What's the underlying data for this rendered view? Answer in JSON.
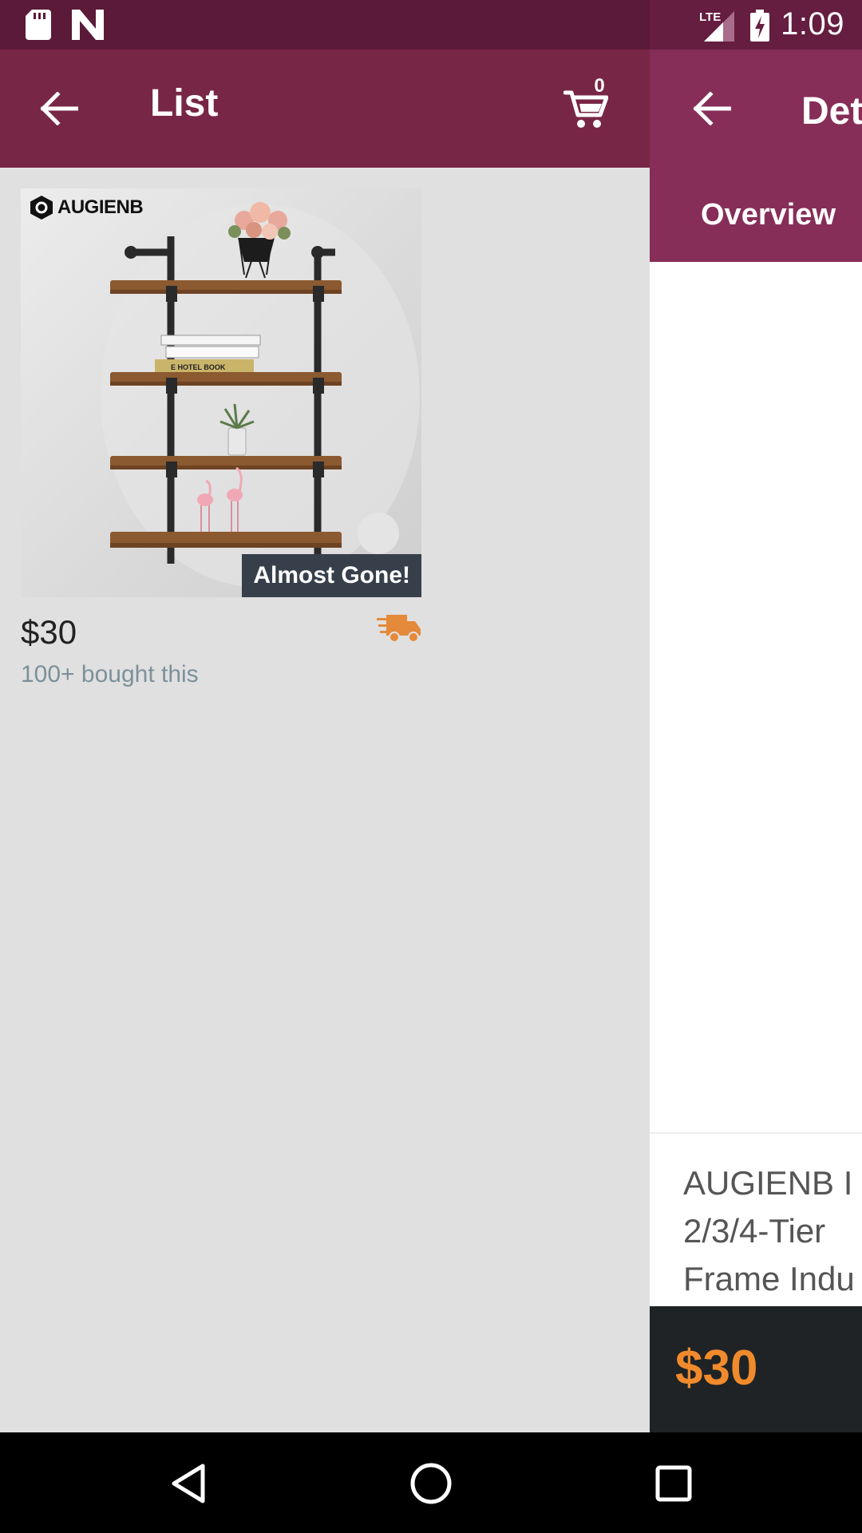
{
  "status_bar": {
    "network": "LTE",
    "time": "1:09",
    "icons": [
      "sd-card-icon",
      "n-logo-icon",
      "lte-signal-icon",
      "battery-charging-icon"
    ]
  },
  "list_screen": {
    "title": "List",
    "cart_count": "0",
    "product": {
      "brand": "AUGIENB",
      "badge": "Almost Gone!",
      "price": "$30",
      "bought_text": "100+ bought this",
      "image_book_text": "E HOTEL BOOK"
    }
  },
  "detail_screen": {
    "title": "Det",
    "tab": "Overview",
    "product_title_lines": [
      "AUGIENB I",
      "2/3/4-Tier",
      "Frame Indu"
    ],
    "price": "$30"
  },
  "colors": {
    "appbar_list": "#782646",
    "appbar_detail": "#862e58",
    "accent_orange": "#f08a2c",
    "badge_bg": "#37404a"
  },
  "nav_bar": {
    "buttons": [
      "back-triangle-icon",
      "home-circle-icon",
      "recents-square-icon"
    ]
  }
}
